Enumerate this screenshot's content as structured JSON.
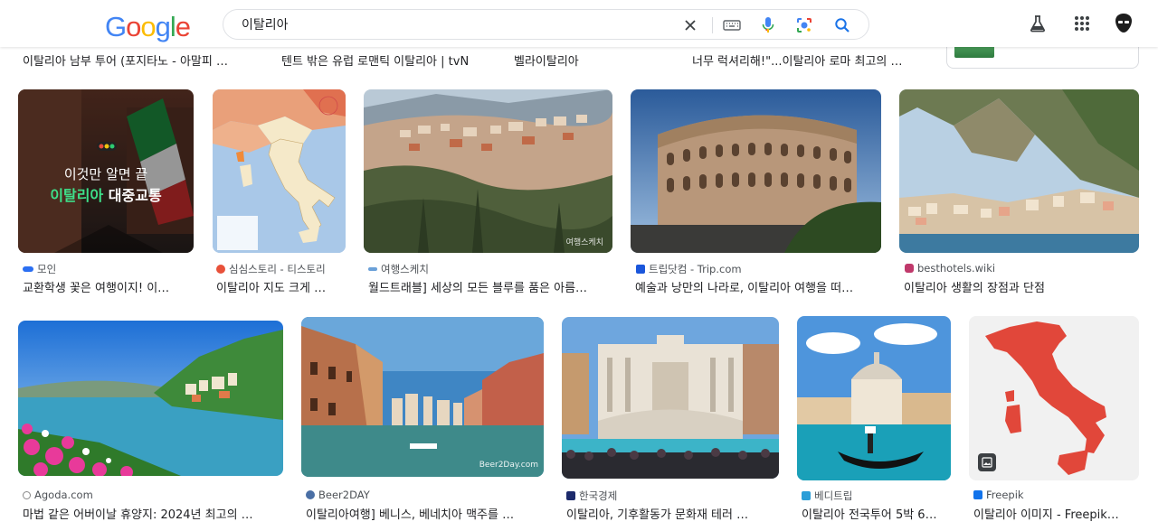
{
  "search": {
    "query": "이탈리아"
  },
  "logo": [
    "G",
    "o",
    "o",
    "g",
    "l",
    "e"
  ],
  "top_strip": [
    "이탈리아 남부 투어 (포지타노 - 아말피 …",
    "텐트 밖은 유럽 로맨틱 이탈리아 | tvN",
    "벨라이탈리아",
    "너무 럭셔리해!\"...이탈리아 로마 최고의 …"
  ],
  "results": [
    {
      "source": "모인",
      "title": "교환학생 꽃은 여행이지! 이…",
      "overlay_line1": "이것만 알면 끝",
      "overlay_line2a": "이탈리아",
      "overlay_line2b": " 대중교통",
      "fav_color": "#2b6ff2"
    },
    {
      "source": "심심스토리 - 티스토리",
      "title": "이탈리아 지도 크게 …",
      "fav_color": "#e8513a"
    },
    {
      "source": "여행스케치",
      "title": "월드트래블] 세상의 모든 블루를 품은 아름…",
      "watermark": "여행스케치",
      "fav_color": "#6aa0d8"
    },
    {
      "source": "트립닷컴 - Trip.com",
      "title": "예술과 낭만의 나라로, 이탈리아 여행을 떠…",
      "fav_color": "#1a56db"
    },
    {
      "source": "besthotels.wiki",
      "title": "이탈리아 생활의 장점과 단점",
      "fav_color": "#c0396b"
    },
    {
      "source": "Agoda.com",
      "title": "마법 같은 어버이날 휴양지: 2024년 최고의 …",
      "fav_color": "#888"
    },
    {
      "source": "Beer2DAY",
      "title": "이탈리아여행] 베니스, 베네치아 맥주를 …",
      "watermark": "Beer2Day.com",
      "fav_color": "#4a6fa5"
    },
    {
      "source": "한국경제",
      "title": "이탈리아, 기후활동가 문화재 테러 …",
      "fav_color": "#1c2a6b"
    },
    {
      "source": "베디트립",
      "title": "이탈리아 전국투어 5박 6…",
      "fav_color": "#2b9ed8"
    },
    {
      "source": "Freepik",
      "title": "이탈리아 이미지 - Freepik…",
      "fav_color": "#1273eb"
    }
  ]
}
